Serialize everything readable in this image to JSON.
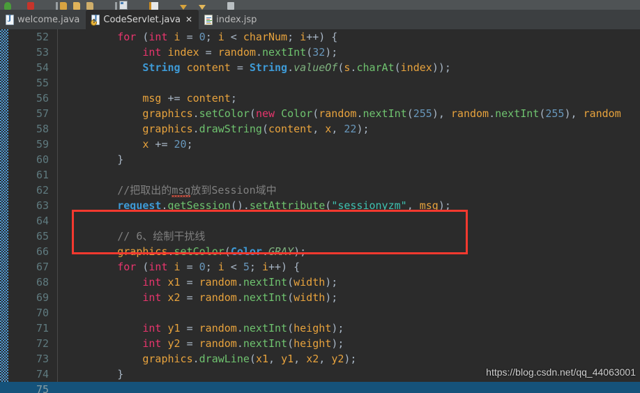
{
  "toolbar": {
    "icons": [
      "run-green-icon",
      "stop-red-icon",
      "folder-open-icon",
      "folder-icon",
      "folder-small-icon",
      "divider-icon",
      "window-icon",
      "bookmark-icon",
      "arrow-down-yellow-icon",
      "arrow-down-yellow2-icon",
      "grey-tool-icon"
    ]
  },
  "tabs": [
    {
      "label": "welcome.java",
      "icon": "java-file-icon",
      "active": false,
      "warning": false,
      "closable": false
    },
    {
      "label": "CodeServlet.java",
      "icon": "java-file-warning-icon",
      "active": true,
      "warning": true,
      "closable": true
    },
    {
      "label": "index.jsp",
      "icon": "jsp-file-icon",
      "active": false,
      "warning": false,
      "closable": false
    }
  ],
  "tab_close_glyph": "✕",
  "editor": {
    "language": "Java",
    "first_line": 52,
    "selected_line": 75,
    "lines": [
      {
        "n": 52,
        "tokens": [
          {
            "t": "        ",
            "c": "pun"
          },
          {
            "t": "for",
            "c": "kw2"
          },
          {
            "t": " (",
            "c": "pun"
          },
          {
            "t": "int",
            "c": "kw2"
          },
          {
            "t": " ",
            "c": "pun"
          },
          {
            "t": "i",
            "c": "var"
          },
          {
            "t": " = ",
            "c": "pun"
          },
          {
            "t": "0",
            "c": "num"
          },
          {
            "t": "; ",
            "c": "pun"
          },
          {
            "t": "i",
            "c": "var"
          },
          {
            "t": " < ",
            "c": "pun"
          },
          {
            "t": "charNum",
            "c": "var"
          },
          {
            "t": "; ",
            "c": "pun"
          },
          {
            "t": "i",
            "c": "var"
          },
          {
            "t": "++) {",
            "c": "pun"
          }
        ]
      },
      {
        "n": 53,
        "tokens": [
          {
            "t": "            ",
            "c": "pun"
          },
          {
            "t": "int",
            "c": "kw2"
          },
          {
            "t": " ",
            "c": "pun"
          },
          {
            "t": "index",
            "c": "var"
          },
          {
            "t": " = ",
            "c": "pun"
          },
          {
            "t": "random",
            "c": "var"
          },
          {
            "t": ".",
            "c": "pun"
          },
          {
            "t": "nextInt",
            "c": "meth"
          },
          {
            "t": "(",
            "c": "pun"
          },
          {
            "t": "32",
            "c": "num"
          },
          {
            "t": ");",
            "c": "pun"
          }
        ]
      },
      {
        "n": 54,
        "tokens": [
          {
            "t": "            ",
            "c": "pun"
          },
          {
            "t": "String",
            "c": "typ"
          },
          {
            "t": " ",
            "c": "pun"
          },
          {
            "t": "content",
            "c": "var"
          },
          {
            "t": " = ",
            "c": "pun"
          },
          {
            "t": "String",
            "c": "typ"
          },
          {
            "t": ".",
            "c": "pun"
          },
          {
            "t": "valueOf",
            "c": "stat"
          },
          {
            "t": "(",
            "c": "pun"
          },
          {
            "t": "s",
            "c": "var"
          },
          {
            "t": ".",
            "c": "pun"
          },
          {
            "t": "charAt",
            "c": "meth"
          },
          {
            "t": "(",
            "c": "pun"
          },
          {
            "t": "index",
            "c": "var"
          },
          {
            "t": "));",
            "c": "pun"
          }
        ]
      },
      {
        "n": 55,
        "tokens": []
      },
      {
        "n": 56,
        "tokens": [
          {
            "t": "            ",
            "c": "pun"
          },
          {
            "t": "msg",
            "c": "var"
          },
          {
            "t": " += ",
            "c": "pun"
          },
          {
            "t": "content",
            "c": "var"
          },
          {
            "t": ";",
            "c": "pun"
          }
        ]
      },
      {
        "n": 57,
        "tokens": [
          {
            "t": "            ",
            "c": "pun"
          },
          {
            "t": "graphics",
            "c": "var"
          },
          {
            "t": ".",
            "c": "pun"
          },
          {
            "t": "setColor",
            "c": "meth"
          },
          {
            "t": "(",
            "c": "pun"
          },
          {
            "t": "new",
            "c": "kw2"
          },
          {
            "t": " ",
            "c": "pun"
          },
          {
            "t": "Color",
            "c": "meth"
          },
          {
            "t": "(",
            "c": "pun"
          },
          {
            "t": "random",
            "c": "var"
          },
          {
            "t": ".",
            "c": "pun"
          },
          {
            "t": "nextInt",
            "c": "meth"
          },
          {
            "t": "(",
            "c": "pun"
          },
          {
            "t": "255",
            "c": "num"
          },
          {
            "t": "), ",
            "c": "pun"
          },
          {
            "t": "random",
            "c": "var"
          },
          {
            "t": ".",
            "c": "pun"
          },
          {
            "t": "nextInt",
            "c": "meth"
          },
          {
            "t": "(",
            "c": "pun"
          },
          {
            "t": "255",
            "c": "num"
          },
          {
            "t": "), ",
            "c": "pun"
          },
          {
            "t": "random",
            "c": "var"
          }
        ]
      },
      {
        "n": 58,
        "tokens": [
          {
            "t": "            ",
            "c": "pun"
          },
          {
            "t": "graphics",
            "c": "var"
          },
          {
            "t": ".",
            "c": "pun"
          },
          {
            "t": "drawString",
            "c": "meth"
          },
          {
            "t": "(",
            "c": "pun"
          },
          {
            "t": "content",
            "c": "var"
          },
          {
            "t": ", ",
            "c": "pun"
          },
          {
            "t": "x",
            "c": "var"
          },
          {
            "t": ", ",
            "c": "pun"
          },
          {
            "t": "22",
            "c": "num"
          },
          {
            "t": ");",
            "c": "pun"
          }
        ]
      },
      {
        "n": 59,
        "tokens": [
          {
            "t": "            ",
            "c": "pun"
          },
          {
            "t": "x",
            "c": "var"
          },
          {
            "t": " += ",
            "c": "pun"
          },
          {
            "t": "20",
            "c": "num"
          },
          {
            "t": ";",
            "c": "pun"
          }
        ]
      },
      {
        "n": 60,
        "tokens": [
          {
            "t": "        }",
            "c": "pun"
          }
        ]
      },
      {
        "n": 61,
        "tokens": []
      },
      {
        "n": 62,
        "tokens": [
          {
            "t": "        ",
            "c": "pun"
          },
          {
            "t": "//把取出的",
            "c": "cmt"
          },
          {
            "t": "msg",
            "c": "squiggle"
          },
          {
            "t": "放到Session域中",
            "c": "cmt"
          }
        ]
      },
      {
        "n": 63,
        "tokens": [
          {
            "t": "        ",
            "c": "pun"
          },
          {
            "t": "request",
            "c": "typ"
          },
          {
            "t": ".",
            "c": "pun"
          },
          {
            "t": "getSession",
            "c": "meth"
          },
          {
            "t": "().",
            "c": "pun"
          },
          {
            "t": "setAttribute",
            "c": "meth"
          },
          {
            "t": "(",
            "c": "pun"
          },
          {
            "t": "\"sessionyzm\"",
            "c": "str"
          },
          {
            "t": ", ",
            "c": "pun"
          },
          {
            "t": "msg",
            "c": "var"
          },
          {
            "t": ");",
            "c": "pun"
          }
        ]
      },
      {
        "n": 64,
        "tokens": []
      },
      {
        "n": 65,
        "tokens": [
          {
            "t": "        ",
            "c": "pun"
          },
          {
            "t": "// 6、绘制干扰线",
            "c": "cmt"
          }
        ]
      },
      {
        "n": 66,
        "tokens": [
          {
            "t": "        ",
            "c": "pun"
          },
          {
            "t": "graphics",
            "c": "var"
          },
          {
            "t": ".",
            "c": "pun"
          },
          {
            "t": "setColor",
            "c": "meth"
          },
          {
            "t": "(",
            "c": "pun"
          },
          {
            "t": "Color",
            "c": "typ"
          },
          {
            "t": ".",
            "c": "pun"
          },
          {
            "t": "GRAY",
            "c": "stat"
          },
          {
            "t": ");",
            "c": "pun"
          }
        ]
      },
      {
        "n": 67,
        "tokens": [
          {
            "t": "        ",
            "c": "pun"
          },
          {
            "t": "for",
            "c": "kw2"
          },
          {
            "t": " (",
            "c": "pun"
          },
          {
            "t": "int",
            "c": "kw2"
          },
          {
            "t": " ",
            "c": "pun"
          },
          {
            "t": "i",
            "c": "var"
          },
          {
            "t": " = ",
            "c": "pun"
          },
          {
            "t": "0",
            "c": "num"
          },
          {
            "t": "; ",
            "c": "pun"
          },
          {
            "t": "i",
            "c": "var"
          },
          {
            "t": " < ",
            "c": "pun"
          },
          {
            "t": "5",
            "c": "num"
          },
          {
            "t": "; ",
            "c": "pun"
          },
          {
            "t": "i",
            "c": "var"
          },
          {
            "t": "++) {",
            "c": "pun"
          }
        ]
      },
      {
        "n": 68,
        "tokens": [
          {
            "t": "            ",
            "c": "pun"
          },
          {
            "t": "int",
            "c": "kw2"
          },
          {
            "t": " ",
            "c": "pun"
          },
          {
            "t": "x1",
            "c": "var"
          },
          {
            "t": " = ",
            "c": "pun"
          },
          {
            "t": "random",
            "c": "var"
          },
          {
            "t": ".",
            "c": "pun"
          },
          {
            "t": "nextInt",
            "c": "meth"
          },
          {
            "t": "(",
            "c": "pun"
          },
          {
            "t": "width",
            "c": "var"
          },
          {
            "t": ");",
            "c": "pun"
          }
        ]
      },
      {
        "n": 69,
        "tokens": [
          {
            "t": "            ",
            "c": "pun"
          },
          {
            "t": "int",
            "c": "kw2"
          },
          {
            "t": " ",
            "c": "pun"
          },
          {
            "t": "x2",
            "c": "var"
          },
          {
            "t": " = ",
            "c": "pun"
          },
          {
            "t": "random",
            "c": "var"
          },
          {
            "t": ".",
            "c": "pun"
          },
          {
            "t": "nextInt",
            "c": "meth"
          },
          {
            "t": "(",
            "c": "pun"
          },
          {
            "t": "width",
            "c": "var"
          },
          {
            "t": ");",
            "c": "pun"
          }
        ]
      },
      {
        "n": 70,
        "tokens": []
      },
      {
        "n": 71,
        "tokens": [
          {
            "t": "            ",
            "c": "pun"
          },
          {
            "t": "int",
            "c": "kw2"
          },
          {
            "t": " ",
            "c": "pun"
          },
          {
            "t": "y1",
            "c": "var"
          },
          {
            "t": " = ",
            "c": "pun"
          },
          {
            "t": "random",
            "c": "var"
          },
          {
            "t": ".",
            "c": "pun"
          },
          {
            "t": "nextInt",
            "c": "meth"
          },
          {
            "t": "(",
            "c": "pun"
          },
          {
            "t": "height",
            "c": "var"
          },
          {
            "t": ");",
            "c": "pun"
          }
        ]
      },
      {
        "n": 72,
        "tokens": [
          {
            "t": "            ",
            "c": "pun"
          },
          {
            "t": "int",
            "c": "kw2"
          },
          {
            "t": " ",
            "c": "pun"
          },
          {
            "t": "y2",
            "c": "var"
          },
          {
            "t": " = ",
            "c": "pun"
          },
          {
            "t": "random",
            "c": "var"
          },
          {
            "t": ".",
            "c": "pun"
          },
          {
            "t": "nextInt",
            "c": "meth"
          },
          {
            "t": "(",
            "c": "pun"
          },
          {
            "t": "height",
            "c": "var"
          },
          {
            "t": ");",
            "c": "pun"
          }
        ]
      },
      {
        "n": 73,
        "tokens": [
          {
            "t": "            ",
            "c": "pun"
          },
          {
            "t": "graphics",
            "c": "var"
          },
          {
            "t": ".",
            "c": "pun"
          },
          {
            "t": "drawLine",
            "c": "meth"
          },
          {
            "t": "(",
            "c": "pun"
          },
          {
            "t": "x1",
            "c": "var"
          },
          {
            "t": ", ",
            "c": "pun"
          },
          {
            "t": "y1",
            "c": "var"
          },
          {
            "t": ", ",
            "c": "pun"
          },
          {
            "t": "x2",
            "c": "var"
          },
          {
            "t": ", ",
            "c": "pun"
          },
          {
            "t": "y2",
            "c": "var"
          },
          {
            "t": ");",
            "c": "pun"
          }
        ]
      },
      {
        "n": 74,
        "tokens": [
          {
            "t": "        }",
            "c": "pun"
          }
        ]
      },
      {
        "n": 75,
        "tokens": []
      }
    ]
  },
  "annotation": {
    "type": "red-rectangle-highlight",
    "covers_lines": [
      62,
      63
    ],
    "color": "#f4392f"
  },
  "watermark": {
    "text": "https://blog.csdn.net/qq_44063001"
  },
  "colors": {
    "editor_background": "#2b2b2b",
    "tabbar_background": "#3c3f41",
    "toolbar_background": "#4f5355",
    "line_number": "#5f7a7f",
    "selection": "#15527a",
    "vcs_marker": "#4e9ad6",
    "keyword": "#e8356d",
    "string": "#3fc1b0",
    "number": "#6897bb",
    "comment": "#808080",
    "method": "#6fc36f",
    "variable": "#e8a33d",
    "class": "#3e9ad6",
    "annotation_red": "#f4392f"
  }
}
